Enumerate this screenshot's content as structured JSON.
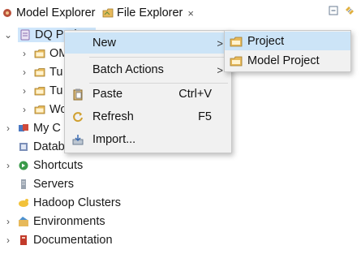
{
  "tabs": [
    {
      "label": "Model Explorer",
      "icon": "model-explorer-icon"
    },
    {
      "label": "File Explorer",
      "icon": "file-explorer-icon",
      "close": "×"
    }
  ],
  "toolbar": {
    "collapse_icon": "collapse-all-icon",
    "link_icon": "link-with-editor-icon"
  },
  "tree": {
    "items": [
      {
        "label": "DQ Project",
        "icon": "project-icon",
        "expanded": true
      },
      {
        "label": "OM",
        "icon": "folder-icon"
      },
      {
        "label": "Tu",
        "icon": "folder-icon"
      },
      {
        "label": "Tu",
        "icon": "folder-icon"
      },
      {
        "label": "Wo",
        "icon": "folder-icon"
      },
      {
        "label": "My C",
        "icon": "my-connections-icon"
      },
      {
        "label": "Databases",
        "icon": "database-icon"
      },
      {
        "label": "Shortcuts",
        "icon": "shortcuts-icon"
      },
      {
        "label": "Servers",
        "icon": "servers-icon"
      },
      {
        "label": "Hadoop Clusters",
        "icon": "hadoop-icon"
      },
      {
        "label": "Environments",
        "icon": "environments-icon"
      },
      {
        "label": "Documentation",
        "icon": "documentation-icon"
      }
    ]
  },
  "context_menu": {
    "new": "New",
    "batch_actions": "Batch Actions",
    "paste": "Paste",
    "paste_accel": "Ctrl+V",
    "refresh": "Refresh",
    "refresh_accel": "F5",
    "import": "Import...",
    "arrow": ">"
  },
  "submenu": {
    "project": "Project",
    "model_project": "Model Project"
  },
  "colors": {
    "selection": "#cfe6fb",
    "menu_bg": "#f1f1f1",
    "menu_hover": "#cce4f7",
    "folder": "#e7b95a"
  }
}
